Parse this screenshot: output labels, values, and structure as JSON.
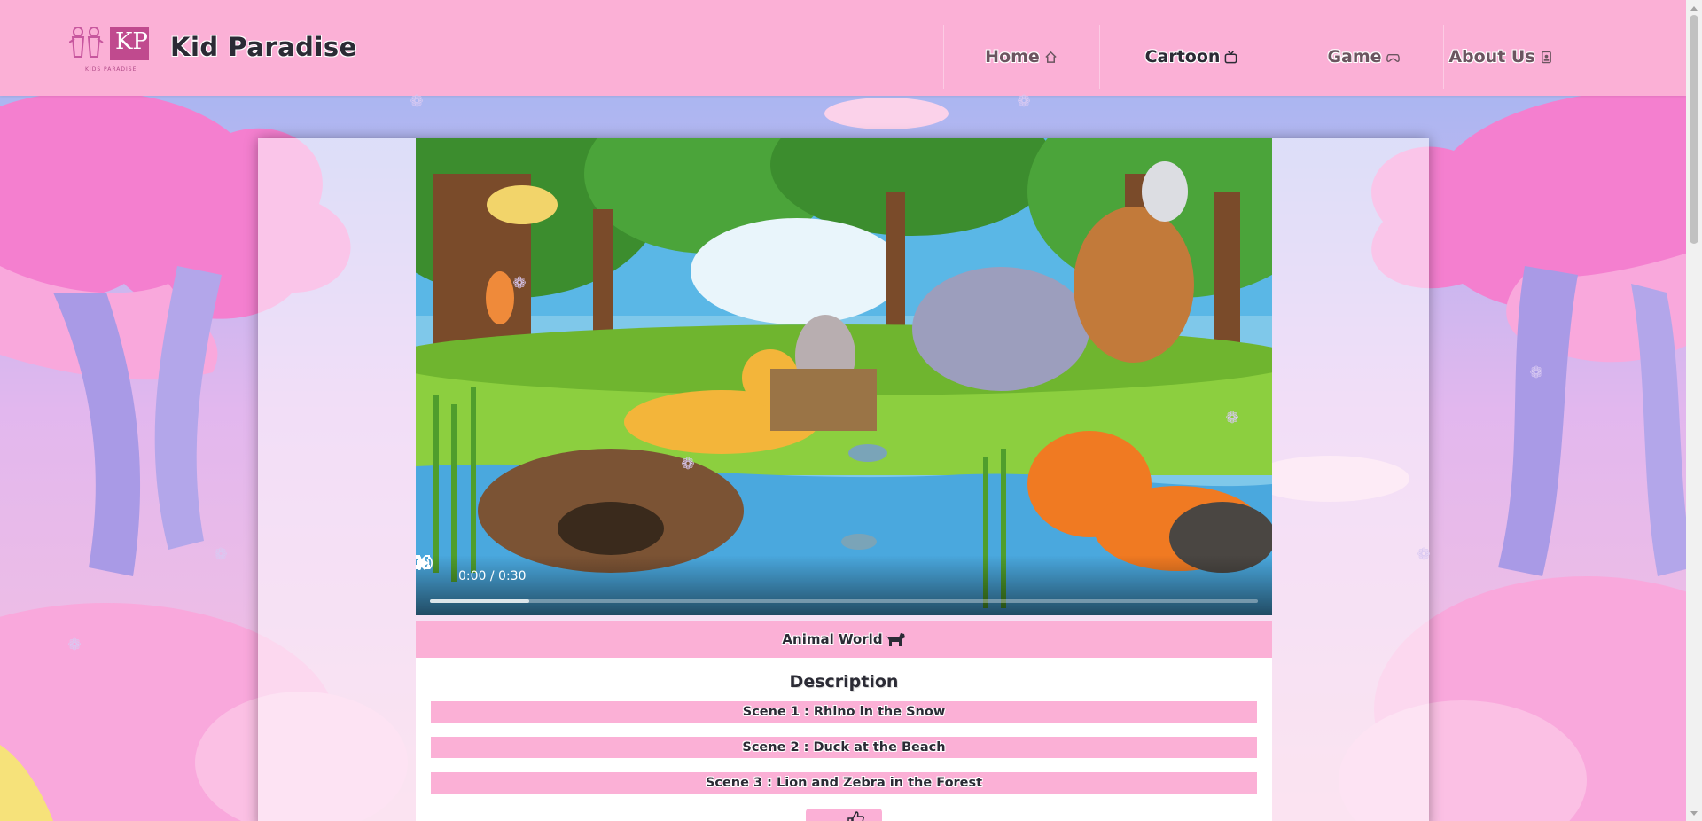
{
  "header": {
    "brand": "Kid Paradise",
    "logo_text": "KP",
    "logo_caption": "KIDS PARADISE",
    "nav": [
      {
        "label": "Home",
        "icon": "home-icon"
      },
      {
        "label": "Cartoon",
        "icon": "tv-icon"
      },
      {
        "label": "Game",
        "icon": "gamepad-icon"
      },
      {
        "label": "About Us",
        "icon": "id-card-icon"
      }
    ],
    "active_nav": "Cartoon"
  },
  "video": {
    "time": "0:00 / 0:30",
    "buffered_fraction": 0.12,
    "title": "Animal World",
    "title_icon": "dog-icon"
  },
  "description": {
    "heading": "Description",
    "scenes": [
      "Scene 1 : Rhino in the Snow",
      "Scene 2 : Duck at the Beach",
      "Scene 3 : Lion and Zebra in the Forest"
    ]
  },
  "colors": {
    "header_pink": "#fbb0d6",
    "text_dark": "#2b2b35",
    "nav_muted": "#6b5560"
  }
}
